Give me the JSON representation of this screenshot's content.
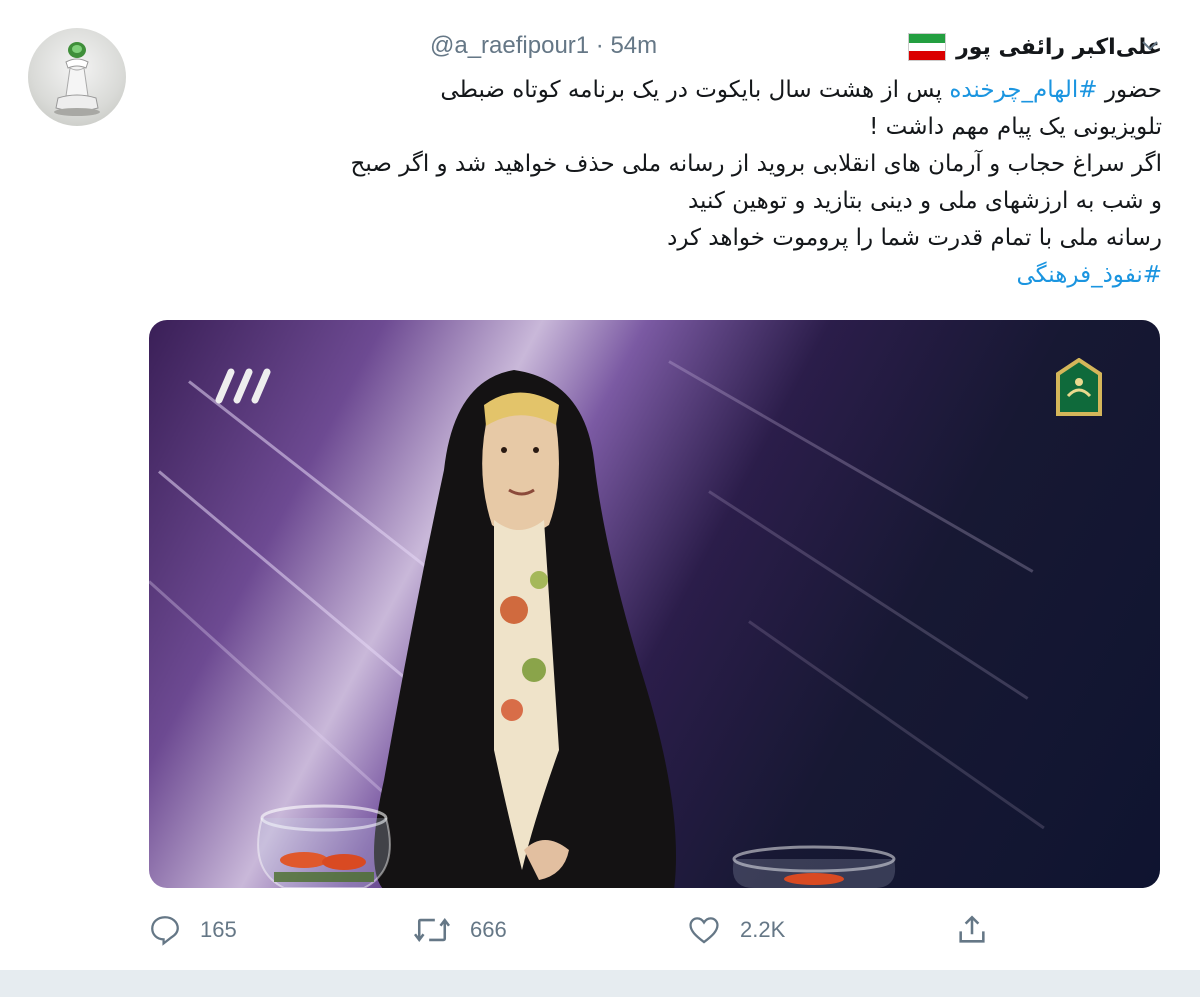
{
  "tweet": {
    "display_name": "علی‌اکبر رائفی پور",
    "handle_and_time": "@a_raefipour1 · 54m",
    "text_lines": [
      {
        "prefix": "حضور ",
        "hashtag": "#الهام_چرخنده",
        "suffix": " پس از هشت سال بایکوت در یک برنامه کوتاه ضبطی"
      },
      {
        "prefix": "تلویزیونی یک پیام مهم داشت !",
        "hashtag": "",
        "suffix": ""
      },
      {
        "prefix": " اگر سراغ حجاب و آرمان های انقلابی بروید از رسانه ملی حذف خواهید شد و اگر صبح",
        "hashtag": "",
        "suffix": ""
      },
      {
        "prefix": "و شب به ارزشهای ملی و دینی بتازید و  توهین کنید",
        "hashtag": "",
        "suffix": ""
      },
      {
        "prefix": "رسانه ملی با تمام قدرت شما را پروموت خواهد کرد",
        "hashtag": "",
        "suffix": ""
      },
      {
        "prefix": "",
        "hashtag": "#نفوذ_فرهنگی",
        "suffix": ""
      }
    ],
    "flag_colors": [
      "#239f40",
      "#ffffff",
      "#da0000"
    ],
    "hashtag_color": "#1b95e0"
  },
  "actions": {
    "reply": {
      "icon": "reply-icon",
      "count": "165"
    },
    "retweet": {
      "icon": "retweet-icon",
      "count": "666"
    },
    "like": {
      "icon": "heart-icon",
      "count": "2.2K"
    },
    "share": {
      "icon": "share-icon"
    }
  }
}
